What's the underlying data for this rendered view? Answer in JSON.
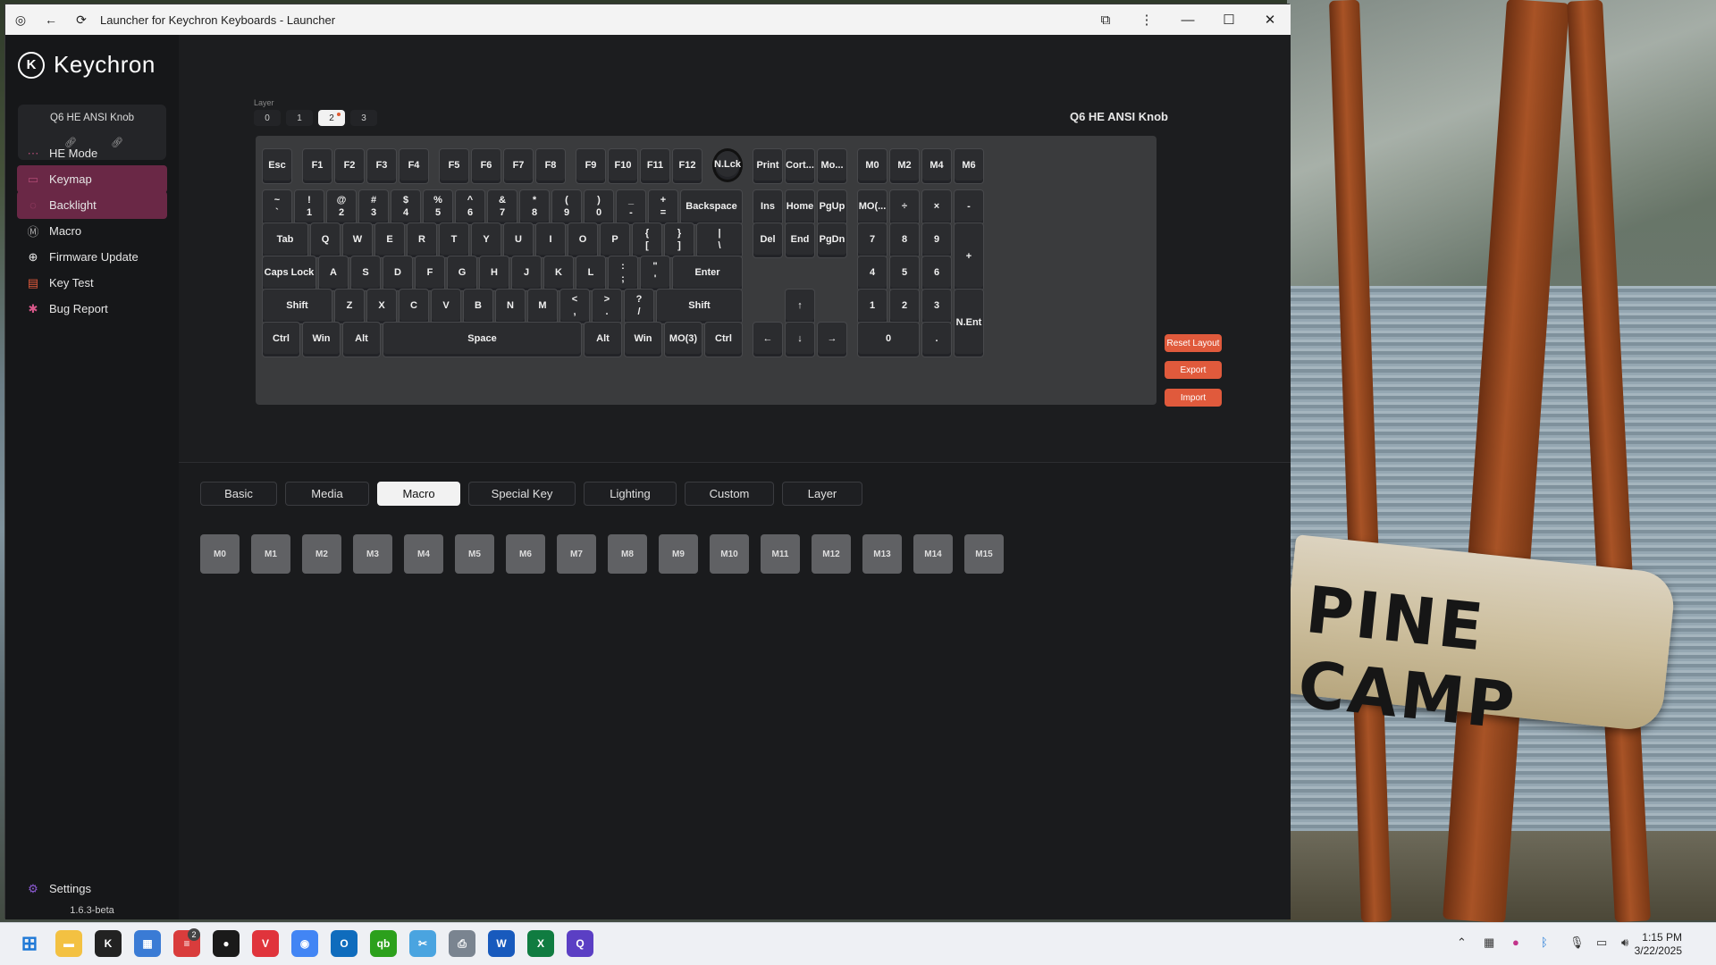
{
  "window": {
    "title": "Launcher for Keychron Keyboards - Launcher"
  },
  "brand": "Keychron",
  "device": {
    "name": "Q6 HE ANSI Knob"
  },
  "nav": [
    {
      "label": "HE Mode",
      "icon": "he-mode-icon"
    },
    {
      "label": "Keymap",
      "icon": "keymap-icon"
    },
    {
      "label": "Backlight",
      "icon": "backlight-icon"
    },
    {
      "label": "Macro",
      "icon": "macro-icon"
    },
    {
      "label": "Firmware Update",
      "icon": "firmware-icon"
    },
    {
      "label": "Key Test",
      "icon": "key-test-icon"
    },
    {
      "label": "Bug Report",
      "icon": "bug-icon"
    }
  ],
  "settings_label": "Settings",
  "version": "1.6.3-beta",
  "layer": {
    "label": "Layer",
    "tabs": [
      "0",
      "1",
      "2",
      "3"
    ],
    "selected": "2"
  },
  "keyboard_name": "Q6 HE ANSI Knob",
  "keys": {
    "row0": [
      "Esc",
      "F1",
      "F2",
      "F3",
      "F4",
      "F5",
      "F6",
      "F7",
      "F8",
      "F9",
      "F10",
      "F11",
      "F12",
      "N.Lck",
      "Print",
      "Cort...",
      "Mo...",
      "M0",
      "M2",
      "M4",
      "M6"
    ],
    "row1": [
      [
        "~",
        "`"
      ],
      [
        "!",
        "1"
      ],
      [
        "@",
        "2"
      ],
      [
        "#",
        "3"
      ],
      [
        "$",
        "4"
      ],
      [
        "%",
        "5"
      ],
      [
        "^",
        "6"
      ],
      [
        "&",
        "7"
      ],
      [
        "*",
        "8"
      ],
      [
        "(",
        "9"
      ],
      [
        ")",
        "0"
      ],
      [
        "_",
        "-"
      ],
      [
        "+",
        "="
      ],
      [
        "Backspace"
      ],
      [
        "Ins"
      ],
      [
        "Home"
      ],
      [
        "PgUp"
      ],
      [
        "MO(..."
      ],
      [
        "÷"
      ],
      [
        "×"
      ],
      [
        "-"
      ]
    ],
    "row2": [
      [
        "Tab"
      ],
      [
        "Q"
      ],
      [
        "W"
      ],
      [
        "E"
      ],
      [
        "R"
      ],
      [
        "T"
      ],
      [
        "Y"
      ],
      [
        "U"
      ],
      [
        "I"
      ],
      [
        "O"
      ],
      [
        "P"
      ],
      [
        "{",
        "["
      ],
      [
        "}",
        "]"
      ],
      [
        "|",
        "\\"
      ],
      [
        "Del"
      ],
      [
        "End"
      ],
      [
        "PgDn"
      ],
      [
        "7"
      ],
      [
        "8"
      ],
      [
        "9"
      ],
      [
        "+"
      ]
    ],
    "row3": [
      [
        "Caps Lock"
      ],
      [
        "A"
      ],
      [
        "S"
      ],
      [
        "D"
      ],
      [
        "F"
      ],
      [
        "G"
      ],
      [
        "H"
      ],
      [
        "J"
      ],
      [
        "K"
      ],
      [
        "L"
      ],
      [
        ":",
        ";"
      ],
      [
        "\"",
        "'"
      ],
      [
        "Enter"
      ],
      [
        "4"
      ],
      [
        "5"
      ],
      [
        "6"
      ]
    ],
    "row4": [
      [
        "Shift"
      ],
      [
        "Z"
      ],
      [
        "X"
      ],
      [
        "C"
      ],
      [
        "V"
      ],
      [
        "B"
      ],
      [
        "N"
      ],
      [
        "M"
      ],
      [
        "<",
        ","
      ],
      [
        ">",
        "."
      ],
      [
        "?",
        "/"
      ],
      [
        "Shift"
      ],
      [
        "↑"
      ],
      [
        "1"
      ],
      [
        "2"
      ],
      [
        "3"
      ],
      [
        "N.Ent"
      ]
    ],
    "row5": [
      [
        "Ctrl"
      ],
      [
        "Win"
      ],
      [
        "Alt"
      ],
      [
        "Space"
      ],
      [
        "Alt"
      ],
      [
        "Win"
      ],
      [
        "MO(3)"
      ],
      [
        "Ctrl"
      ],
      [
        "←"
      ],
      [
        "↓"
      ],
      [
        "→"
      ],
      [
        "0"
      ],
      [
        "."
      ]
    ]
  },
  "actions": {
    "reset": "Reset Layout",
    "export": "Export",
    "import": "Import"
  },
  "tabs": [
    "Basic",
    "Media",
    "Macro",
    "Special Key",
    "Lighting",
    "Custom",
    "Layer"
  ],
  "selected_tab": "Macro",
  "macros": [
    "M0",
    "M1",
    "M2",
    "M3",
    "M4",
    "M5",
    "M6",
    "M7",
    "M8",
    "M9",
    "M10",
    "M11",
    "M12",
    "M13",
    "M14",
    "M15"
  ],
  "background_sign": "PINE CAMP",
  "taskbar": {
    "badge": "2",
    "time": "1:15 PM",
    "date": "3/22/2025"
  }
}
